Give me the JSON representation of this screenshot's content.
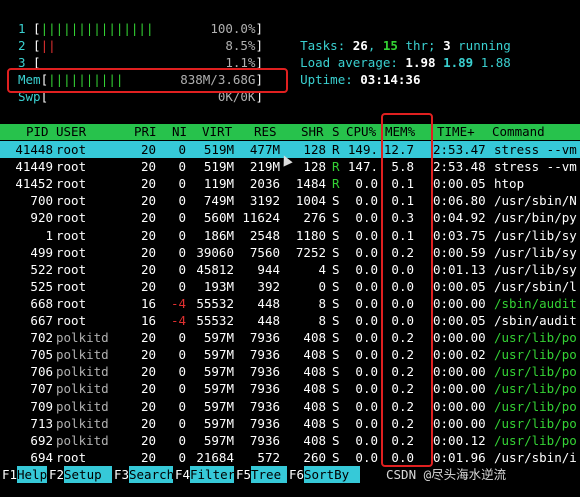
{
  "cpus": [
    {
      "num": "1",
      "bars": "|||||||||||||||",
      "pct": "100.0%"
    },
    {
      "num": "2",
      "bars": "||",
      "pct": "8.5%"
    },
    {
      "num": "3",
      "bars": "",
      "pct": "1.1%"
    }
  ],
  "mem": {
    "label": "Mem",
    "bars": "||||||||||",
    "value": "838M/3.68G"
  },
  "swp": {
    "label": "Swp",
    "bars": "",
    "value": "0K/0K"
  },
  "tasks": {
    "label": "Tasks: ",
    "count": "26",
    "sep": ", ",
    "threads": "15",
    "thr_label": " thr; ",
    "running": "3",
    "run_label": " running"
  },
  "load": {
    "label": "Load average: ",
    "l1": "1.98",
    "l5": "1.89",
    "l15": "1.88"
  },
  "uptime": {
    "label": "Uptime: ",
    "value": "03:14:36"
  },
  "columns": [
    "PID",
    "USER",
    "PRI",
    "NI",
    "VIRT",
    "RES",
    "SHR",
    "S",
    "CPU%",
    "MEM%",
    "TIME+",
    "Command"
  ],
  "processes": [
    {
      "pid": "41448",
      "user": "root",
      "pri": "20",
      "ni": "0",
      "virt": "519M",
      "res": "477M",
      "shr": "128",
      "s": "R",
      "cpu": "149.",
      "mem": "12.7",
      "time": "2:53.47",
      "cmd": "stress --vm"
    },
    {
      "pid": "41449",
      "user": "root",
      "pri": "20",
      "ni": "0",
      "virt": "519M",
      "res": "219M",
      "shr": "128",
      "s": "R",
      "cpu": "147.",
      "mem": "5.8",
      "time": "2:53.48",
      "cmd": "stress --vm"
    },
    {
      "pid": "41452",
      "user": "root",
      "pri": "20",
      "ni": "0",
      "virt": "119M",
      "res": "2036",
      "shr": "1484",
      "s": "R",
      "cpu": "0.0",
      "mem": "0.1",
      "time": "0:00.05",
      "cmd": "htop"
    },
    {
      "pid": "700",
      "user": "root",
      "pri": "20",
      "ni": "0",
      "virt": "749M",
      "res": "3192",
      "shr": "1004",
      "s": "S",
      "cpu": "0.0",
      "mem": "0.1",
      "time": "0:06.80",
      "cmd": "/usr/sbin/N"
    },
    {
      "pid": "920",
      "user": "root",
      "pri": "20",
      "ni": "0",
      "virt": "560M",
      "res": "11624",
      "shr": "276",
      "s": "S",
      "cpu": "0.0",
      "mem": "0.3",
      "time": "0:04.92",
      "cmd": "/usr/bin/py"
    },
    {
      "pid": "1",
      "user": "root",
      "pri": "20",
      "ni": "0",
      "virt": "186M",
      "res": "2548",
      "shr": "1180",
      "s": "S",
      "cpu": "0.0",
      "mem": "0.1",
      "time": "0:03.75",
      "cmd": "/usr/lib/sy"
    },
    {
      "pid": "499",
      "user": "root",
      "pri": "20",
      "ni": "0",
      "virt": "39060",
      "res": "7560",
      "shr": "7252",
      "s": "S",
      "cpu": "0.0",
      "mem": "0.2",
      "time": "0:00.59",
      "cmd": "/usr/lib/sy"
    },
    {
      "pid": "522",
      "user": "root",
      "pri": "20",
      "ni": "0",
      "virt": "45812",
      "res": "944",
      "shr": "4",
      "s": "S",
      "cpu": "0.0",
      "mem": "0.0",
      "time": "0:01.13",
      "cmd": "/usr/lib/sy"
    },
    {
      "pid": "525",
      "user": "root",
      "pri": "20",
      "ni": "0",
      "virt": "193M",
      "res": "392",
      "shr": "0",
      "s": "S",
      "cpu": "0.0",
      "mem": "0.0",
      "time": "0:00.05",
      "cmd": "/usr/sbin/l"
    },
    {
      "pid": "668",
      "user": "root",
      "pri": "16",
      "ni": "-4",
      "virt": "55532",
      "res": "448",
      "shr": "8",
      "s": "S",
      "cpu": "0.0",
      "mem": "0.0",
      "time": "0:00.00",
      "cmd": "/sbin/audit"
    },
    {
      "pid": "667",
      "user": "root",
      "pri": "16",
      "ni": "-4",
      "virt": "55532",
      "res": "448",
      "shr": "8",
      "s": "S",
      "cpu": "0.0",
      "mem": "0.0",
      "time": "0:00.05",
      "cmd": "/sbin/audit"
    },
    {
      "pid": "702",
      "user": "polkitd",
      "pri": "20",
      "ni": "0",
      "virt": "597M",
      "res": "7936",
      "shr": "408",
      "s": "S",
      "cpu": "0.0",
      "mem": "0.2",
      "time": "0:00.00",
      "cmd": "/usr/lib/po"
    },
    {
      "pid": "705",
      "user": "polkitd",
      "pri": "20",
      "ni": "0",
      "virt": "597M",
      "res": "7936",
      "shr": "408",
      "s": "S",
      "cpu": "0.0",
      "mem": "0.2",
      "time": "0:00.02",
      "cmd": "/usr/lib/po"
    },
    {
      "pid": "706",
      "user": "polkitd",
      "pri": "20",
      "ni": "0",
      "virt": "597M",
      "res": "7936",
      "shr": "408",
      "s": "S",
      "cpu": "0.0",
      "mem": "0.2",
      "time": "0:00.00",
      "cmd": "/usr/lib/po"
    },
    {
      "pid": "707",
      "user": "polkitd",
      "pri": "20",
      "ni": "0",
      "virt": "597M",
      "res": "7936",
      "shr": "408",
      "s": "S",
      "cpu": "0.0",
      "mem": "0.2",
      "time": "0:00.00",
      "cmd": "/usr/lib/po"
    },
    {
      "pid": "709",
      "user": "polkitd",
      "pri": "20",
      "ni": "0",
      "virt": "597M",
      "res": "7936",
      "shr": "408",
      "s": "S",
      "cpu": "0.0",
      "mem": "0.2",
      "time": "0:00.00",
      "cmd": "/usr/lib/po"
    },
    {
      "pid": "713",
      "user": "polkitd",
      "pri": "20",
      "ni": "0",
      "virt": "597M",
      "res": "7936",
      "shr": "408",
      "s": "S",
      "cpu": "0.0",
      "mem": "0.2",
      "time": "0:00.00",
      "cmd": "/usr/lib/po"
    },
    {
      "pid": "692",
      "user": "polkitd",
      "pri": "20",
      "ni": "0",
      "virt": "597M",
      "res": "7936",
      "shr": "408",
      "s": "S",
      "cpu": "0.0",
      "mem": "0.2",
      "time": "0:00.12",
      "cmd": "/usr/lib/po"
    },
    {
      "pid": "694",
      "user": "root",
      "pri": "20",
      "ni": "0",
      "virt": "21684",
      "res": "572",
      "shr": "260",
      "s": "S",
      "cpu": "0.0",
      "mem": "0.0",
      "time": "0:01.96",
      "cmd": "/usr/sbin/i"
    }
  ],
  "footer": [
    {
      "key": "F1",
      "label": "Help"
    },
    {
      "key": "F2",
      "label": "Setup"
    },
    {
      "key": "F3",
      "label": "Search"
    },
    {
      "key": "F4",
      "label": "Filter"
    },
    {
      "key": "F5",
      "label": "Tree"
    },
    {
      "key": "F6",
      "label": "SortBy"
    }
  ],
  "watermark": "CSDN @尽头海水逆流",
  "colors": {
    "header_bg": "#27c24c",
    "selected_bg": "#36c9d8",
    "highlight_box": "#e02020",
    "cyan": "#3ad0d0",
    "green": "#34d234",
    "red": "#e03030"
  }
}
